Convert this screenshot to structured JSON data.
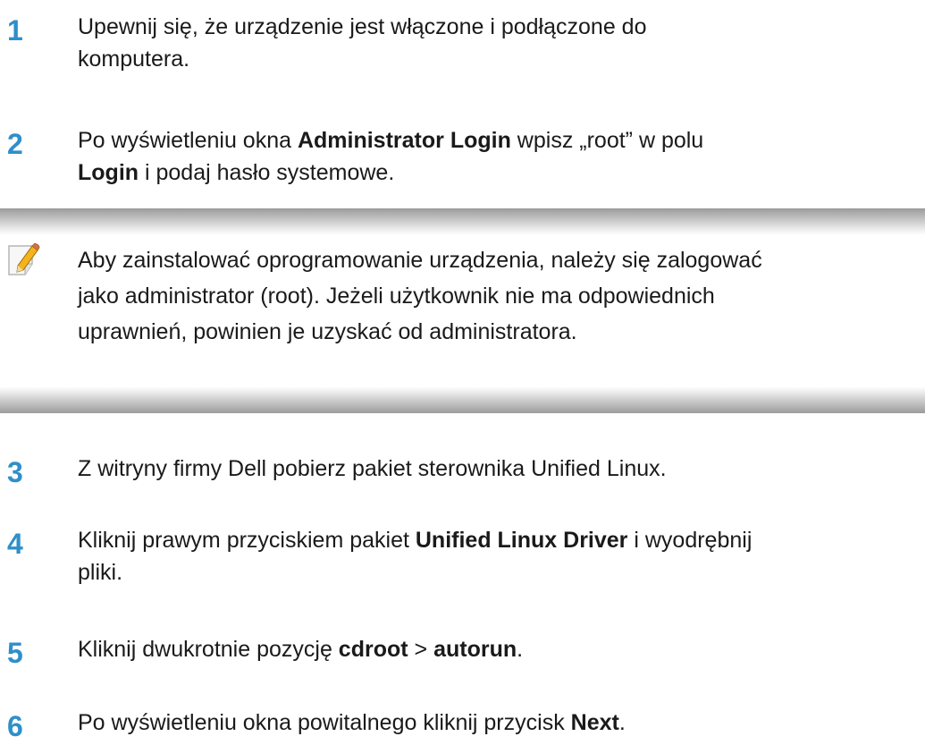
{
  "steps_top": [
    {
      "number": "1",
      "line1": "Upewnij się, że urządzenie jest włączone i podłączone do",
      "line2": "komputera."
    },
    {
      "number": "2",
      "line1_pre": "Po wyświetleniu okna ",
      "line1_bold": "Administrator Login",
      "line1_post": " wpisz „root” w polu",
      "line2_bold": "Login",
      "line2_post": " i podaj hasło systemowe."
    }
  ],
  "note": {
    "icon": "note-pencil-icon",
    "lines": [
      "Aby zainstalować oprogramowanie urządzenia, należy się zalogować",
      "jako administrator (root). Jeżeli użytkownik nie ma odpowiednich",
      "uprawnień, powinien je uzyskać od administratora."
    ]
  },
  "steps_bottom": [
    {
      "number": "3",
      "line1": "Z witryny firmy Dell pobierz pakiet sterownika Unified Linux."
    },
    {
      "number": "4",
      "line1_pre": "Kliknij prawym przyciskiem pakiet ",
      "line1_bold": "Unified Linux Driver",
      "line1_post": " i wyodrębnij",
      "line2": "pliki."
    },
    {
      "number": "5",
      "pre": "Kliknij dwukrotnie pozycję ",
      "bold1": "cdroot",
      "mid": " > ",
      "bold2": "autorun",
      "post": "."
    },
    {
      "number": "6",
      "pre": "Po wyświetleniu okna powitalnego kliknij przycisk ",
      "bold": "Next",
      "post": "."
    }
  ],
  "colors": {
    "step_number": "#2f8fc9",
    "text": "#1a1a1a",
    "note_band": "#9b9b9b"
  }
}
